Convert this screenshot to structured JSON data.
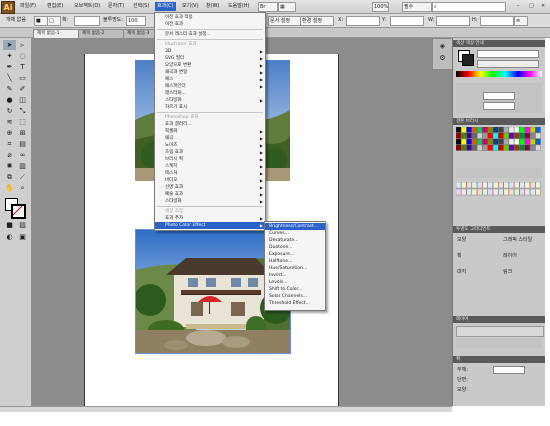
{
  "menubar": {
    "items": [
      "파일(F)",
      "편집(E)",
      "오브젝트(O)",
      "문자(T)",
      "선택(S)",
      "효과(C)",
      "보기(V)",
      "창(W)",
      "도움말(H)"
    ],
    "active_index": 5,
    "zoom": "100%",
    "right_controls": [
      "필수"
    ]
  },
  "controlbar": {
    "left_label": "개체 없음",
    "stroke_label": "획:",
    "opacity_label": "불투명도:",
    "opacity_value": "100",
    "doc_setup": "문서 설정",
    "prefs": "환경 설정",
    "x_label": "X:",
    "y_label": "Y:",
    "w_label": "W:",
    "h_label": "H:"
  },
  "tabs": [
    "제목 없음-1",
    "제목 없음-2",
    "제목 없음-3"
  ],
  "effect_menu": {
    "items": [
      {
        "label": "이전 효과 적용",
        "dim": false
      },
      {
        "label": "이전 효과",
        "dim": false
      },
      {
        "label": "문서 래스터 효과 설정...",
        "dim": false
      },
      {
        "label": "Illustrator 효과",
        "dim": true,
        "header": true
      },
      {
        "label": "3D",
        "arrow": true
      },
      {
        "label": "SVG 필터",
        "arrow": true
      },
      {
        "label": "모양으로 변환",
        "arrow": true
      },
      {
        "label": "왜곡과 변형",
        "arrow": true
      },
      {
        "label": "패스",
        "arrow": true
      },
      {
        "label": "패스파인더",
        "arrow": true
      },
      {
        "label": "래스터화...",
        "arrow": false
      },
      {
        "label": "스타일화",
        "arrow": true
      },
      {
        "label": "자르기 표시",
        "arrow": false
      },
      {
        "label": "Photoshop 효과",
        "dim": true,
        "header": true
      },
      {
        "label": "효과 갤러리...",
        "arrow": false
      },
      {
        "label": "픽셀화",
        "arrow": true
      },
      {
        "label": "왜곡",
        "arrow": true
      },
      {
        "label": "노이즈",
        "arrow": true
      },
      {
        "label": "흐림 효과",
        "arrow": true
      },
      {
        "label": "브러시 획",
        "arrow": true
      },
      {
        "label": "스케치",
        "arrow": true
      },
      {
        "label": "텍스처",
        "arrow": true
      },
      {
        "label": "비디오",
        "arrow": true
      },
      {
        "label": "선명 효과",
        "arrow": true
      },
      {
        "label": "예술 효과",
        "arrow": true
      },
      {
        "label": "스타일화",
        "arrow": true
      },
      {
        "label": "색상 조정",
        "dim": true,
        "header": true
      },
      {
        "label": "효과 추가",
        "arrow": true
      },
      {
        "label": "Photo Color Effect",
        "arrow": true,
        "highlight": true
      }
    ]
  },
  "submenu": {
    "items": [
      "Brightness/Contrast...",
      "Curves...",
      "Desaturate...",
      "Duotone...",
      "Exposure...",
      "Halftone...",
      "Hue/Saturation...",
      "Invert...",
      "Levels...",
      "Shift to Color...",
      "Solar Channels...",
      "Threshold Effect..."
    ],
    "highlight_index": 0
  },
  "panels": {
    "color": {
      "title": "색상",
      "tab2": "색상 안내"
    },
    "swatches": {
      "title": "견본",
      "tab2": "브러시"
    },
    "transparency": {
      "labels": [
        "투명도",
        "그라디언트"
      ]
    },
    "appearance": {
      "labels": [
        "모양",
        "그래픽 스타일",
        "획",
        "레이어",
        "대지",
        "링크"
      ]
    },
    "layers": {
      "title": "레이어",
      "count": "1 레이어"
    },
    "bottom": {
      "title": "획",
      "labels": [
        "두께:",
        "단면:",
        "모양:"
      ]
    }
  },
  "statusbar": {
    "zoom": "100%",
    "status": "선택"
  },
  "colors": {
    "menu_highlight": "#2a62c9",
    "panel_bg": "#c9c9c9",
    "workspace": "#8c8c8c",
    "panel_header": "#5a5a5a"
  }
}
